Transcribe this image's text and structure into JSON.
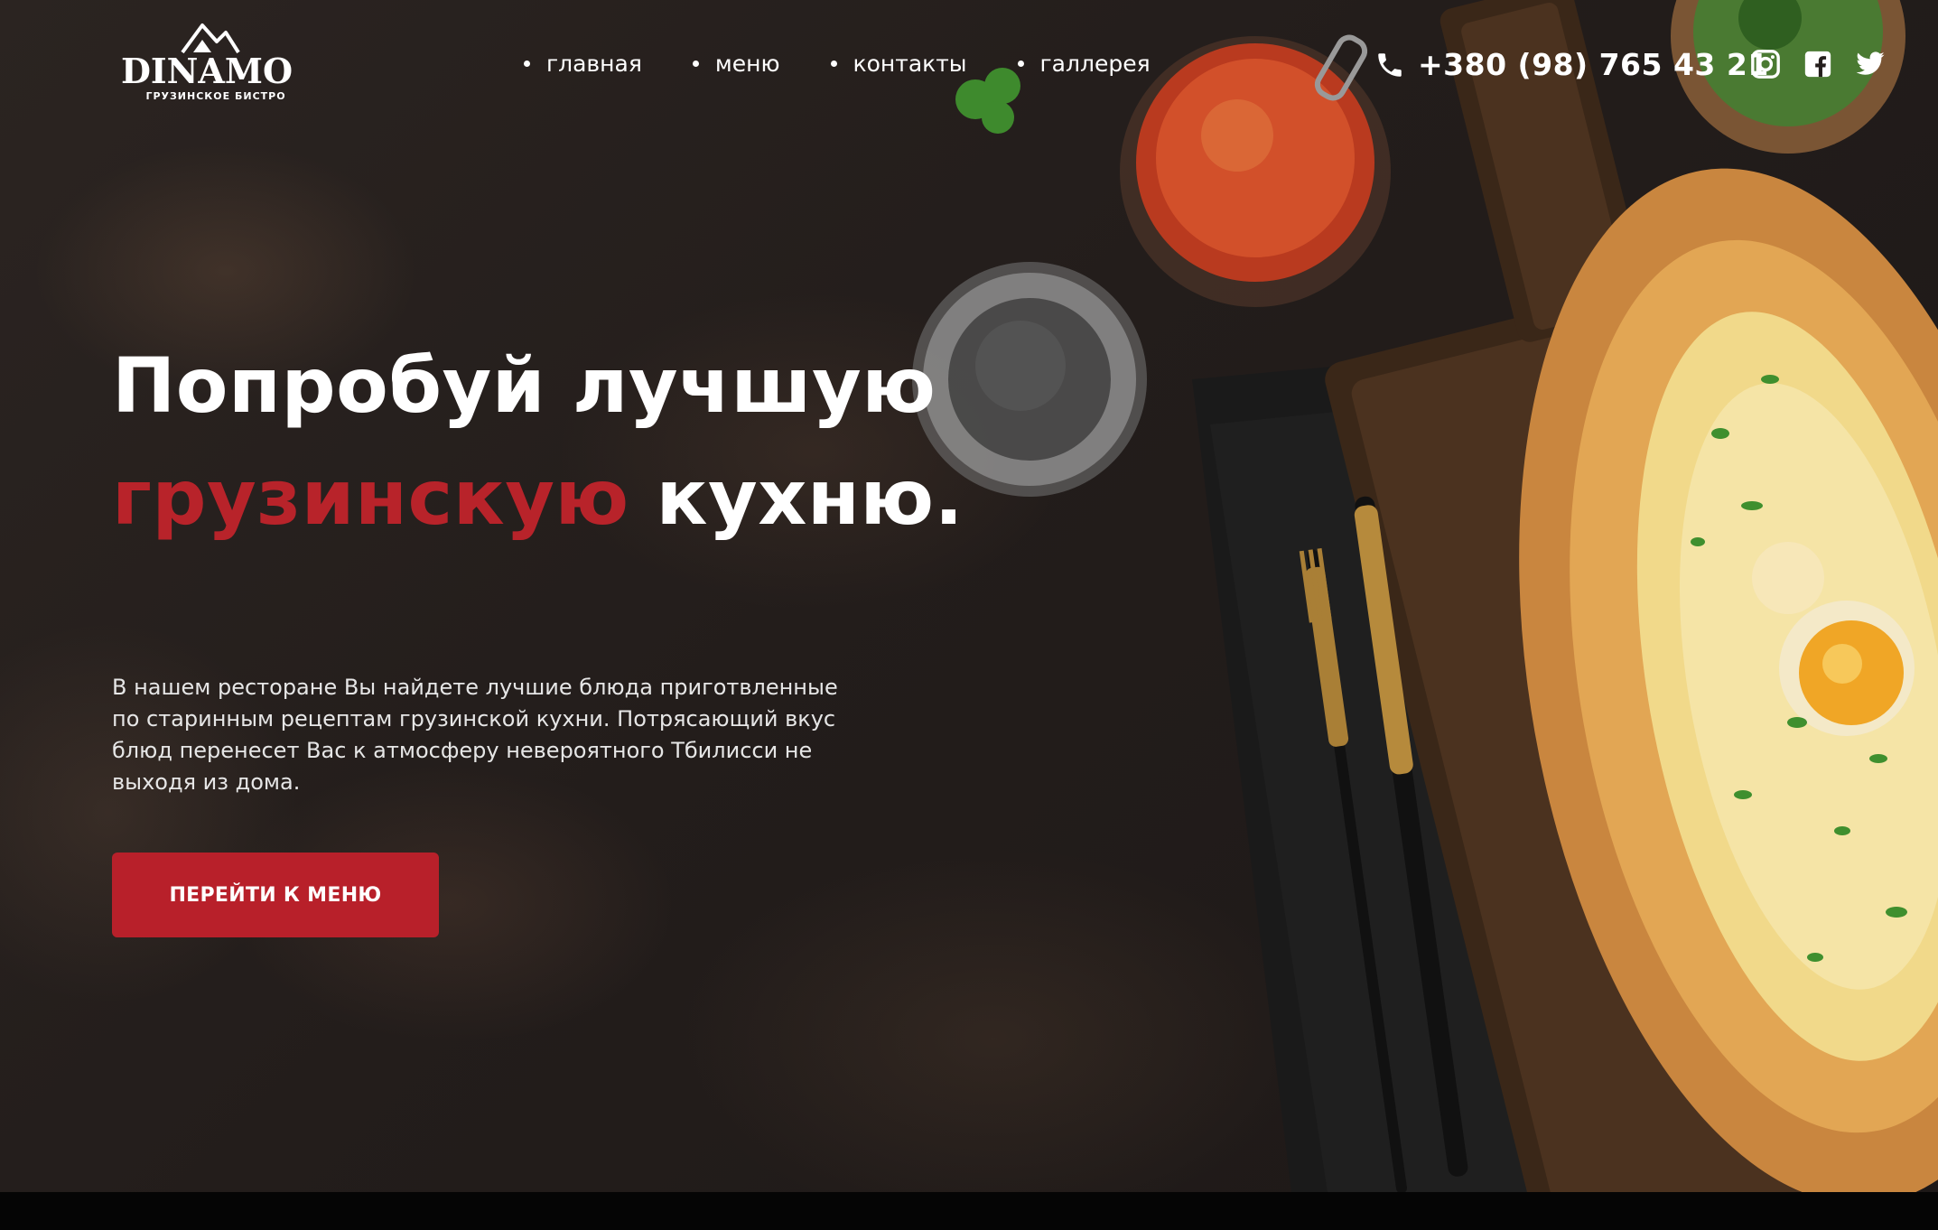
{
  "brand": {
    "logo_text": "DINAMO",
    "logo_subtitle": "ГРУЗИНСКОЕ БИСТРО"
  },
  "nav": {
    "items": [
      {
        "label": "главная"
      },
      {
        "label": "меню"
      },
      {
        "label": "контакты"
      },
      {
        "label": "галлерея"
      }
    ]
  },
  "contact": {
    "phone": "+380 (98) 765 43 21",
    "icon": "phone-icon"
  },
  "socials": [
    {
      "icon": "instagram-icon"
    },
    {
      "icon": "facebook-icon"
    },
    {
      "icon": "twitter-icon"
    }
  ],
  "hero": {
    "headline_line1": "Попробуй лучшую",
    "headline_accent": "грузинскую",
    "headline_rest": " кухню.",
    "description": "В нашем ресторане Вы найдете лучшие блюда приготвленные по старинным рецептам грузинской кухни. Потрясающий вкус блюд перенесет Вас к атмосферу невероятного Тбилисси не выходя из дома.",
    "cta_label": "ПЕРЕЙТИ К МЕНЮ"
  },
  "colors": {
    "accent": "#b8232a",
    "background": "#241e1c",
    "text": "#ffffff"
  }
}
